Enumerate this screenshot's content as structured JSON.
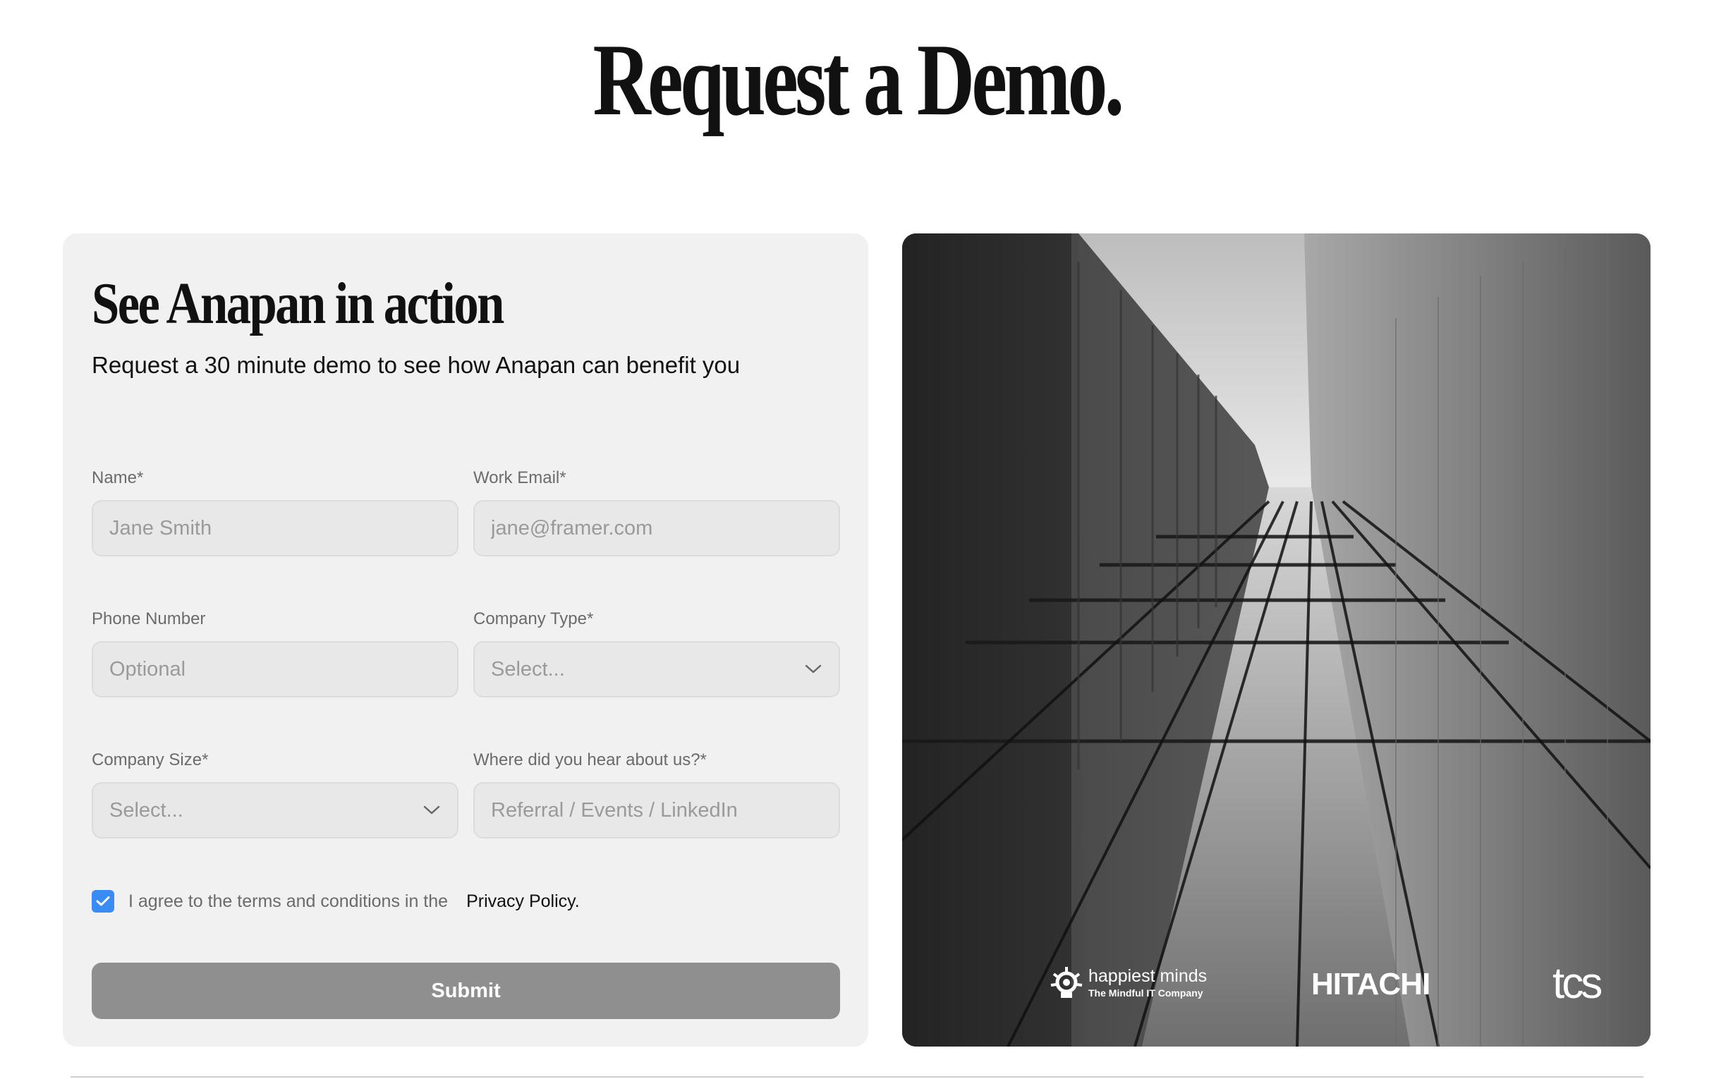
{
  "page": {
    "title": "Request a Demo."
  },
  "form": {
    "heading": "See Anapan in action",
    "subheading": "Request a 30 minute demo to see how Anapan can benefit you",
    "fields": {
      "name": {
        "label": "Name*",
        "placeholder": "Jane Smith"
      },
      "email": {
        "label": "Work Email*",
        "placeholder": "jane@framer.com"
      },
      "phone": {
        "label": "Phone Number",
        "placeholder": "Optional"
      },
      "company_type": {
        "label": "Company Type*",
        "selected": "Select..."
      },
      "company_size": {
        "label": "Company Size*",
        "selected": "Select..."
      },
      "source": {
        "label": "Where did you hear about us?*",
        "placeholder": "Referral / Events / LinkedIn"
      }
    },
    "consent": {
      "checked": true,
      "text": "I agree to the terms and conditions in the",
      "link_label": "Privacy Policy."
    },
    "submit_label": "Submit"
  },
  "logos": {
    "happiest_minds": {
      "name": "happiest minds",
      "tagline": "The Mindful IT Company"
    },
    "hitachi": {
      "name": "HITACHI"
    },
    "tcs": {
      "name": "tcs"
    }
  },
  "colors": {
    "accent": "#3b8bf5",
    "card_background": "#f1f1f1",
    "input_background": "#e8e8e8",
    "submit_background": "#8f8f8f",
    "text_primary": "#111111",
    "text_muted": "#6b6b6b",
    "placeholder": "#9a9a9a"
  },
  "icons": {
    "checkbox": "check-icon",
    "select_chevron": "chevron-down-icon",
    "hm_logo": "gear-bulb-icon"
  }
}
